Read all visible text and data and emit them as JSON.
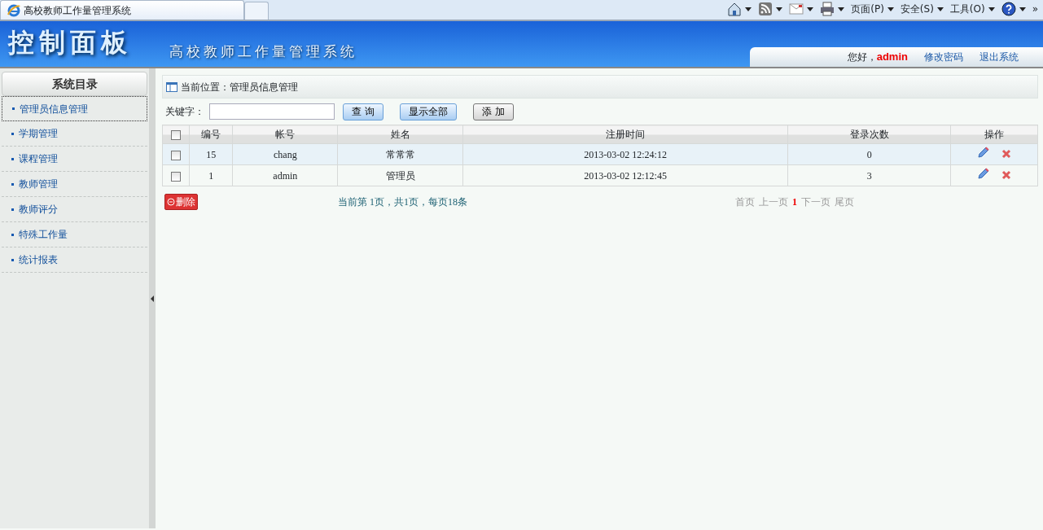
{
  "browser": {
    "tabs": [
      {
        "title": "高校教师工作量管理系统",
        "selected": true
      },
      {
        "selected": false
      }
    ],
    "toolbar": [
      {
        "kind": "icon"
      },
      {
        "kind": "icon"
      },
      {
        "kind": "icon"
      },
      {
        "kind": "icon"
      },
      {
        "kind": "menu",
        "label": "页面(P)"
      },
      {
        "kind": "menu",
        "label": "安全(S)"
      },
      {
        "kind": "menu",
        "label": "工具(O)"
      },
      {
        "kind": "icon"
      }
    ],
    "overflow": "»"
  },
  "header": {
    "logo": "控制面板",
    "system_name": "高校教师工作量管理系统",
    "greeting": "您好，",
    "user": "admin",
    "links": [
      "修改密码",
      "退出系统"
    ]
  },
  "sidebar": {
    "title": "系统目录",
    "items": [
      {
        "label": "管理员信息管理",
        "selected": true
      },
      {
        "label": "学期管理",
        "selected": false
      },
      {
        "label": "课程管理",
        "selected": false
      },
      {
        "label": "教师管理",
        "selected": false
      },
      {
        "label": "教师评分",
        "selected": false
      },
      {
        "label": "特殊工作量",
        "selected": false
      },
      {
        "label": "统计报表",
        "selected": false
      }
    ]
  },
  "breadcrumb": "当前位置：管理员信息管理",
  "search": {
    "label": "关键字：",
    "buttons": [
      "查 询",
      "显示全部",
      "添 加"
    ]
  },
  "table": {
    "select_all_checked": false,
    "columns": [
      "编号",
      "帐号",
      "姓名",
      "注册时间",
      "登录次数",
      "操作"
    ],
    "rows": [
      {
        "checked": false,
        "hovered": true,
        "cells": [
          "15",
          "chang",
          "常常常",
          "2013-03-02 12:24:12",
          "0"
        ]
      },
      {
        "checked": false,
        "hovered": false,
        "cells": [
          "1",
          "admin",
          "管理员",
          "2013-03-02 12:12:45",
          "3"
        ]
      }
    ]
  },
  "delete_button": "删除",
  "page_info": "当前第 1页，共1页，每页18条",
  "pager": [
    {
      "label": "首页",
      "kind": "link",
      "disabled": true
    },
    {
      "label": "上一页",
      "kind": "link",
      "disabled": true
    },
    {
      "label": "1",
      "kind": "current"
    },
    {
      "label": "下一页",
      "kind": "link",
      "disabled": true
    },
    {
      "label": "尾页",
      "kind": "link",
      "disabled": true
    }
  ]
}
